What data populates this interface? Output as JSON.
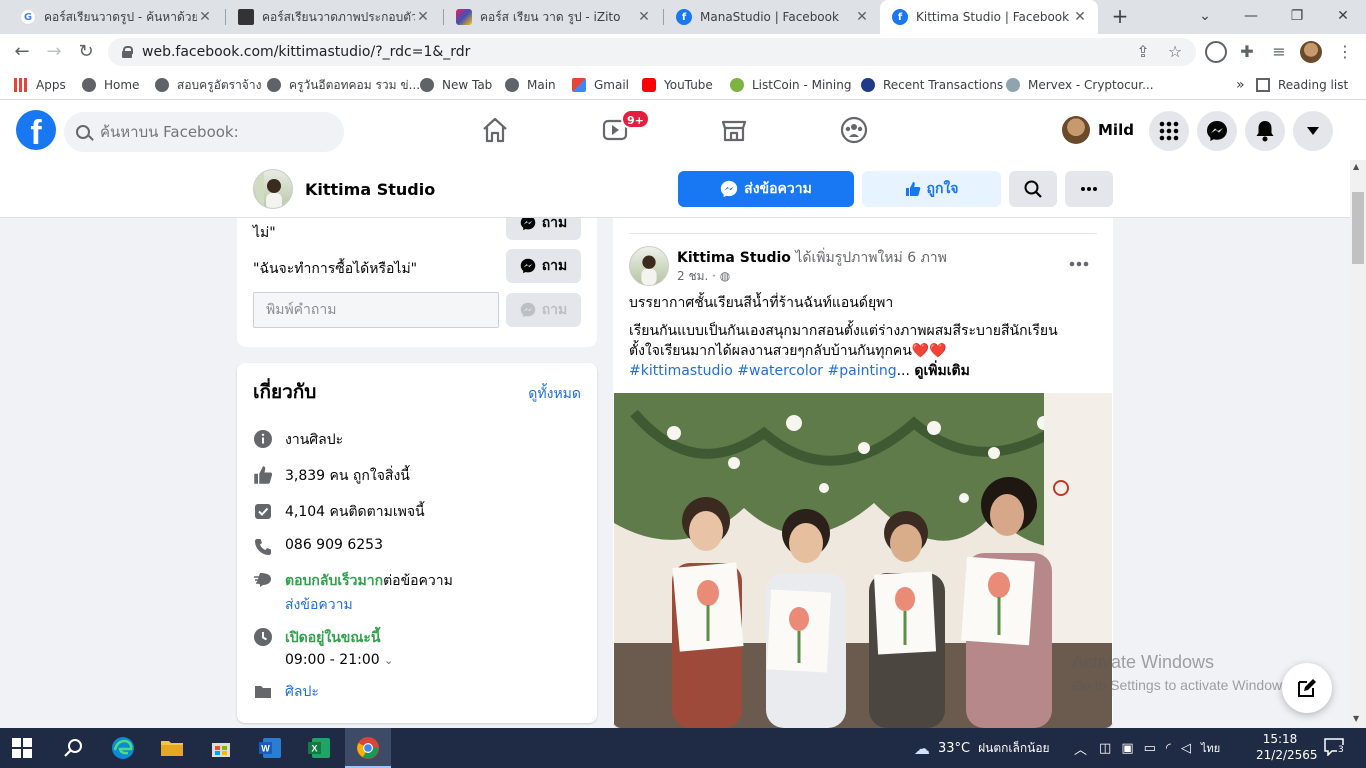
{
  "browser": {
    "tabs": [
      {
        "title": "คอร์สเรียนวาดรูป - ค้นหาด้วย Google",
        "icon": "google-icon"
      },
      {
        "title": "คอร์สเรียนวาดภาพประกอบตัวต่อตัว",
        "icon": "page-icon"
      },
      {
        "title": "คอร์ส เรียน วาด รูป - iZito",
        "icon": "izito-icon"
      },
      {
        "title": "ManaStudio | Facebook",
        "icon": "facebook-icon"
      },
      {
        "title": "Kittima Studio | Facebook",
        "icon": "facebook-icon",
        "active": true
      }
    ],
    "url": "web.facebook.com/kittimastudio/?_rdc=1&_rdr",
    "bookmarks": [
      "Apps",
      "Home",
      "สอบครูอัตราจ้าง",
      "ครูวันอีตอทคอม รวม ข่...",
      "New Tab",
      "Main",
      "Gmail",
      "YouTube",
      "ListCoin - Mining",
      "Recent Transactions",
      "Mervex - Cryptocur..."
    ],
    "bookmarks_overflow": "»",
    "reading_list": "Reading list"
  },
  "facebook": {
    "search_placeholder": "ค้นหาบน Facebook:",
    "watch_badge": "9+",
    "user_name": "Mild"
  },
  "page": {
    "name": "Kittima Studio",
    "message_button": "ส่งข้อความ",
    "like_button": "ถูกใจ"
  },
  "questions": {
    "q1_partial": "ไม่\"",
    "q2": "\"ฉันจะทำการซื้อได้หรือไม่\"",
    "ask_label": "ถาม",
    "input_placeholder": "พิมพ์คำถาม"
  },
  "about": {
    "title": "เกี่ยวกับ",
    "see_all": "ดูทั้งหมด",
    "category": "งานศิลปะ",
    "likes": "3,839 คน ถูกใจสิ่งนี้",
    "followers": "4,104 คนติดตามเพจนี้",
    "phone": "086 909 6253",
    "response_fast": "ตอบกลับเร็วมาก",
    "response_rest": "ต่อข้อความ",
    "send_message": "ส่งข้อความ",
    "open_now": "เปิดอยู่ในขณะนี้",
    "hours": "09:00 - 21:00",
    "category_link": "ศิลปะ"
  },
  "post": {
    "author": "Kittima Studio",
    "action": " ได้เพิ่มรูปภาพใหม่ 6 ภาพ",
    "time": "2 ชม. ·",
    "line1": "บรรยากาศชั้นเรียนสีน้ำที่ร้านฉันท์แอนด์ยุพา",
    "line2": "เรียนกันแบบเป็นกันเองสนุกมากสอนตั้งแต่ร่างภาพผสมสีระบายสีนักเรียน",
    "line3": "ตั้งใจเรียนมากได้ผลงานสวยๆกลับบ้านกันทุกคน❤️❤️",
    "hashtags": "#kittimastudio #watercolor #painting",
    "ellipsis": "...",
    "see_more": "ดูเพิ่มเติม"
  },
  "overlay": {
    "activate_title": "Activate Windows",
    "activate_sub": "Go to Settings to activate Windows."
  },
  "taskbar": {
    "weather": "33°C",
    "weather_text": "ฝนตกเล็กน้อย",
    "lang": "ไทย",
    "time": "15:18",
    "date": "21/2/2565",
    "notifications": "3"
  }
}
